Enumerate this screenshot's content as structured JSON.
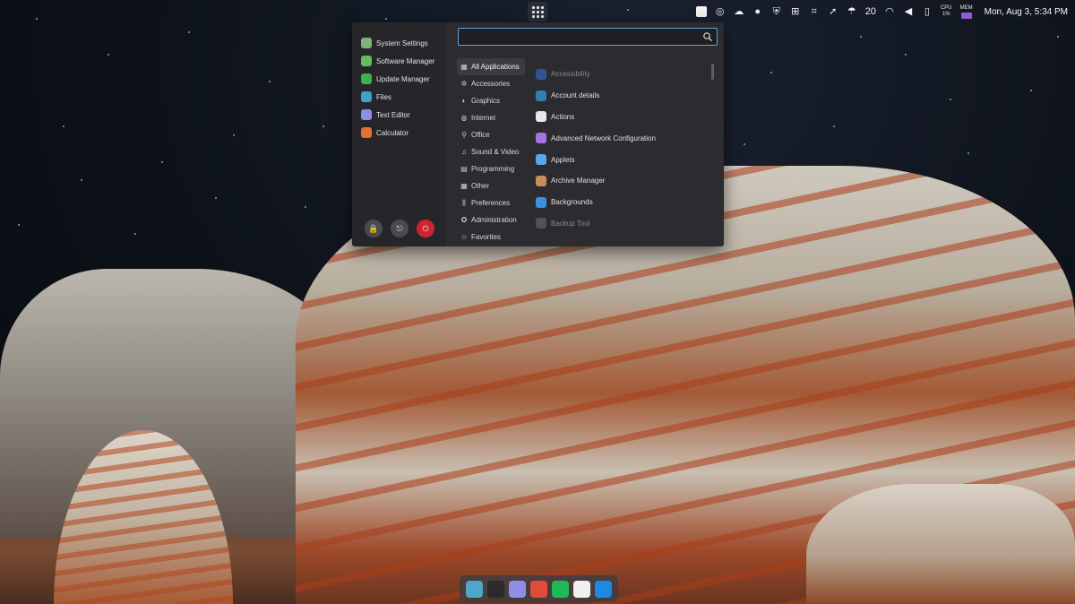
{
  "top_panel": {
    "app_grid_icon": "apps-grid-icon",
    "tray": {
      "temperature": "20",
      "cpu_label": "CPU",
      "cpu_value": "1%",
      "mem_label": "MEM",
      "clock": "Mon, Aug 3, 5:34 PM"
    }
  },
  "menu": {
    "search": {
      "value": "",
      "placeholder": ""
    },
    "favorites": [
      {
        "label": "System Settings",
        "icon": "settings-icon",
        "color": "#7fb27b"
      },
      {
        "label": "Software Manager",
        "icon": "software-manager-icon",
        "color": "#5fbf5a"
      },
      {
        "label": "Update Manager",
        "icon": "update-manager-icon",
        "color": "#3fae4f"
      },
      {
        "label": "Files",
        "icon": "folder-icon",
        "color": "#3aa3c7"
      },
      {
        "label": "Text Editor",
        "icon": "text-editor-icon",
        "color": "#8d8ee8"
      },
      {
        "label": "Calculator",
        "icon": "calculator-icon",
        "color": "#e0732f"
      }
    ],
    "categories": [
      {
        "label": "All Applications",
        "icon": "grid-icon",
        "glyph": "▦",
        "active": true
      },
      {
        "label": "Accessories",
        "icon": "accessories-icon",
        "glyph": "✲",
        "active": false
      },
      {
        "label": "Graphics",
        "icon": "graphics-icon",
        "glyph": "◐",
        "active": false
      },
      {
        "label": "Internet",
        "icon": "internet-icon",
        "glyph": "◍",
        "active": false
      },
      {
        "label": "Office",
        "icon": "office-icon",
        "glyph": "⚲",
        "active": false
      },
      {
        "label": "Sound & Video",
        "icon": "sound-video-icon",
        "glyph": "♫",
        "active": false
      },
      {
        "label": "Programming",
        "icon": "programming-icon",
        "glyph": "▤",
        "active": false
      },
      {
        "label": "Other",
        "icon": "other-icon",
        "glyph": "▦",
        "active": false
      },
      {
        "label": "Preferences",
        "icon": "preferences-icon",
        "glyph": "⫼",
        "active": false
      },
      {
        "label": "Administration",
        "icon": "administration-icon",
        "glyph": "✪",
        "active": false
      },
      {
        "label": "Favorites",
        "icon": "favorites-star-icon",
        "glyph": "☆",
        "active": false
      }
    ],
    "apps": [
      {
        "label": "Accessibility",
        "icon": "accessibility-icon",
        "color": "#3b6fd1",
        "dim": true
      },
      {
        "label": "Account details",
        "icon": "account-icon",
        "color": "#2f7fb0",
        "dim": false
      },
      {
        "label": "Actions",
        "icon": "actions-icon",
        "color": "#e8e8e8",
        "dim": false
      },
      {
        "label": "Advanced Network Configuration",
        "icon": "network-config-icon",
        "color": "#a672e0",
        "dim": false
      },
      {
        "label": "Applets",
        "icon": "applets-icon",
        "color": "#5aa6e6",
        "dim": false
      },
      {
        "label": "Archive Manager",
        "icon": "archive-manager-icon",
        "color": "#c98c5a",
        "dim": false
      },
      {
        "label": "Backgrounds",
        "icon": "backgrounds-icon",
        "color": "#3e8fe3",
        "dim": false
      },
      {
        "label": "Backup Tool",
        "icon": "backup-tool-icon",
        "color": "#6c6c70",
        "dim": true
      }
    ],
    "session": [
      {
        "name": "lock-button",
        "icon": "lock-icon",
        "glyph": "🔒"
      },
      {
        "name": "logout-button",
        "icon": "logout-icon",
        "glyph": "⎋"
      },
      {
        "name": "power-button",
        "icon": "power-icon",
        "glyph": "⏻"
      }
    ]
  },
  "dock": {
    "apps": [
      {
        "name": "files",
        "icon": "folder-icon",
        "color": "#4fa6c9"
      },
      {
        "name": "terminal",
        "icon": "terminal-icon",
        "color": "#2a2a2e"
      },
      {
        "name": "text-editor",
        "icon": "text-editor-icon",
        "color": "#8d8ee8"
      },
      {
        "name": "chrome",
        "icon": "chrome-icon",
        "color": "#e14b3b"
      },
      {
        "name": "spotify",
        "icon": "spotify-icon",
        "color": "#1db954"
      },
      {
        "name": "window",
        "icon": "window-icon",
        "color": "#f0f0f0"
      },
      {
        "name": "vscode",
        "icon": "vscode-icon",
        "color": "#1c8ae0"
      }
    ]
  }
}
